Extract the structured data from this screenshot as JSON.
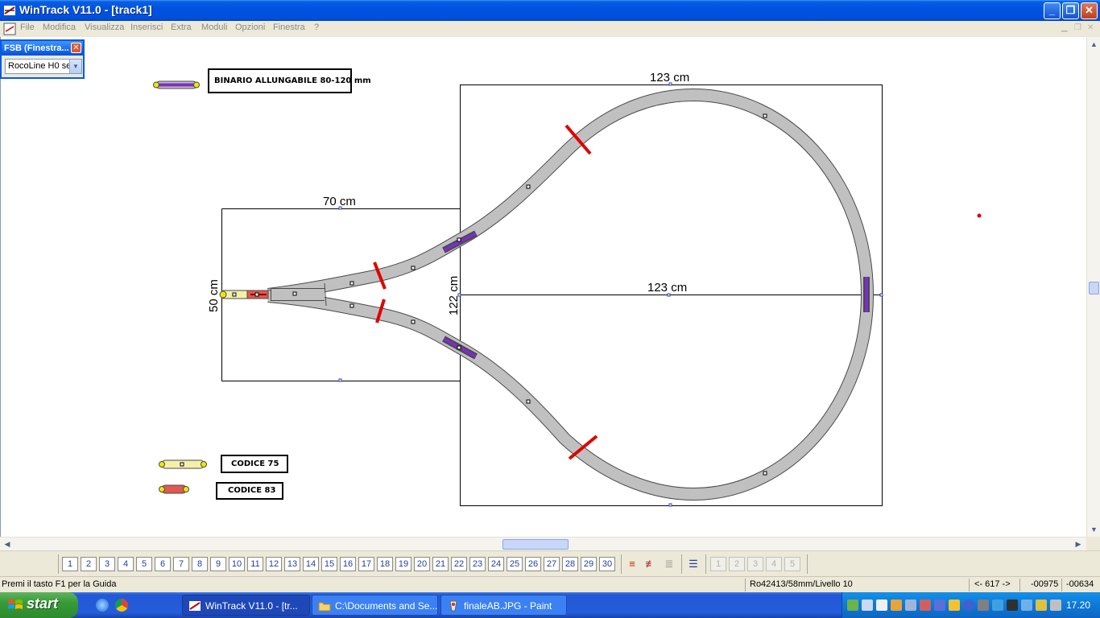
{
  "window": {
    "title": "WinTrack  V11.0 - [track1]",
    "minimize_glyph": "_",
    "restore_glyph": "❐",
    "close_glyph": "✕"
  },
  "menu": [
    "File",
    "Modifica",
    "Visualizza",
    "Inserisci",
    "Extra",
    "Moduli",
    "Opzioni",
    "Finestra",
    "?"
  ],
  "fsb_panel": {
    "title": "FSB (Finestra...",
    "selected": "RocoLine H0 se"
  },
  "legend": {
    "extendable_track": "BINARIO ALLUNGABILE 80-120 mm",
    "code75": "CODICE 75",
    "code83": "CODICE 83"
  },
  "dimensions": {
    "top_width": "123 cm",
    "middle_width": "123 cm",
    "left_width": "70 cm",
    "left_height": "50 cm",
    "box_height": "122 cm"
  },
  "levels": [
    "1",
    "2",
    "3",
    "4",
    "5",
    "6",
    "7",
    "8",
    "9",
    "10",
    "11",
    "12",
    "13",
    "14",
    "15",
    "16",
    "17",
    "18",
    "19",
    "20",
    "21",
    "22",
    "23",
    "24",
    "25",
    "26",
    "27",
    "28",
    "29",
    "30"
  ],
  "levels_dim": [
    "1",
    "2",
    "3",
    "4",
    "5"
  ],
  "status": {
    "help": "Premi il tasto F1 per la Guida",
    "info": "Ro42413/58mm/Livello 10",
    "offset": "<- 617 ->",
    "x": "-00975",
    "y": "-00634"
  },
  "taskbar": {
    "start": "start",
    "tasks": [
      {
        "label": "WinTrack  V11.0 - [tr...",
        "active": true
      },
      {
        "label": "C:\\Documents and Se...",
        "active": false
      },
      {
        "label": "finaleAB.JPG - Paint",
        "active": false
      }
    ],
    "clock": "17.20"
  },
  "colors": {
    "track": "#c0c0c0",
    "track_edge": "#4a4a4a",
    "extendable": "#7b2ec9",
    "code75": "#f5f0a8",
    "code83": "#e05a4f",
    "isolator": "#e00000"
  }
}
